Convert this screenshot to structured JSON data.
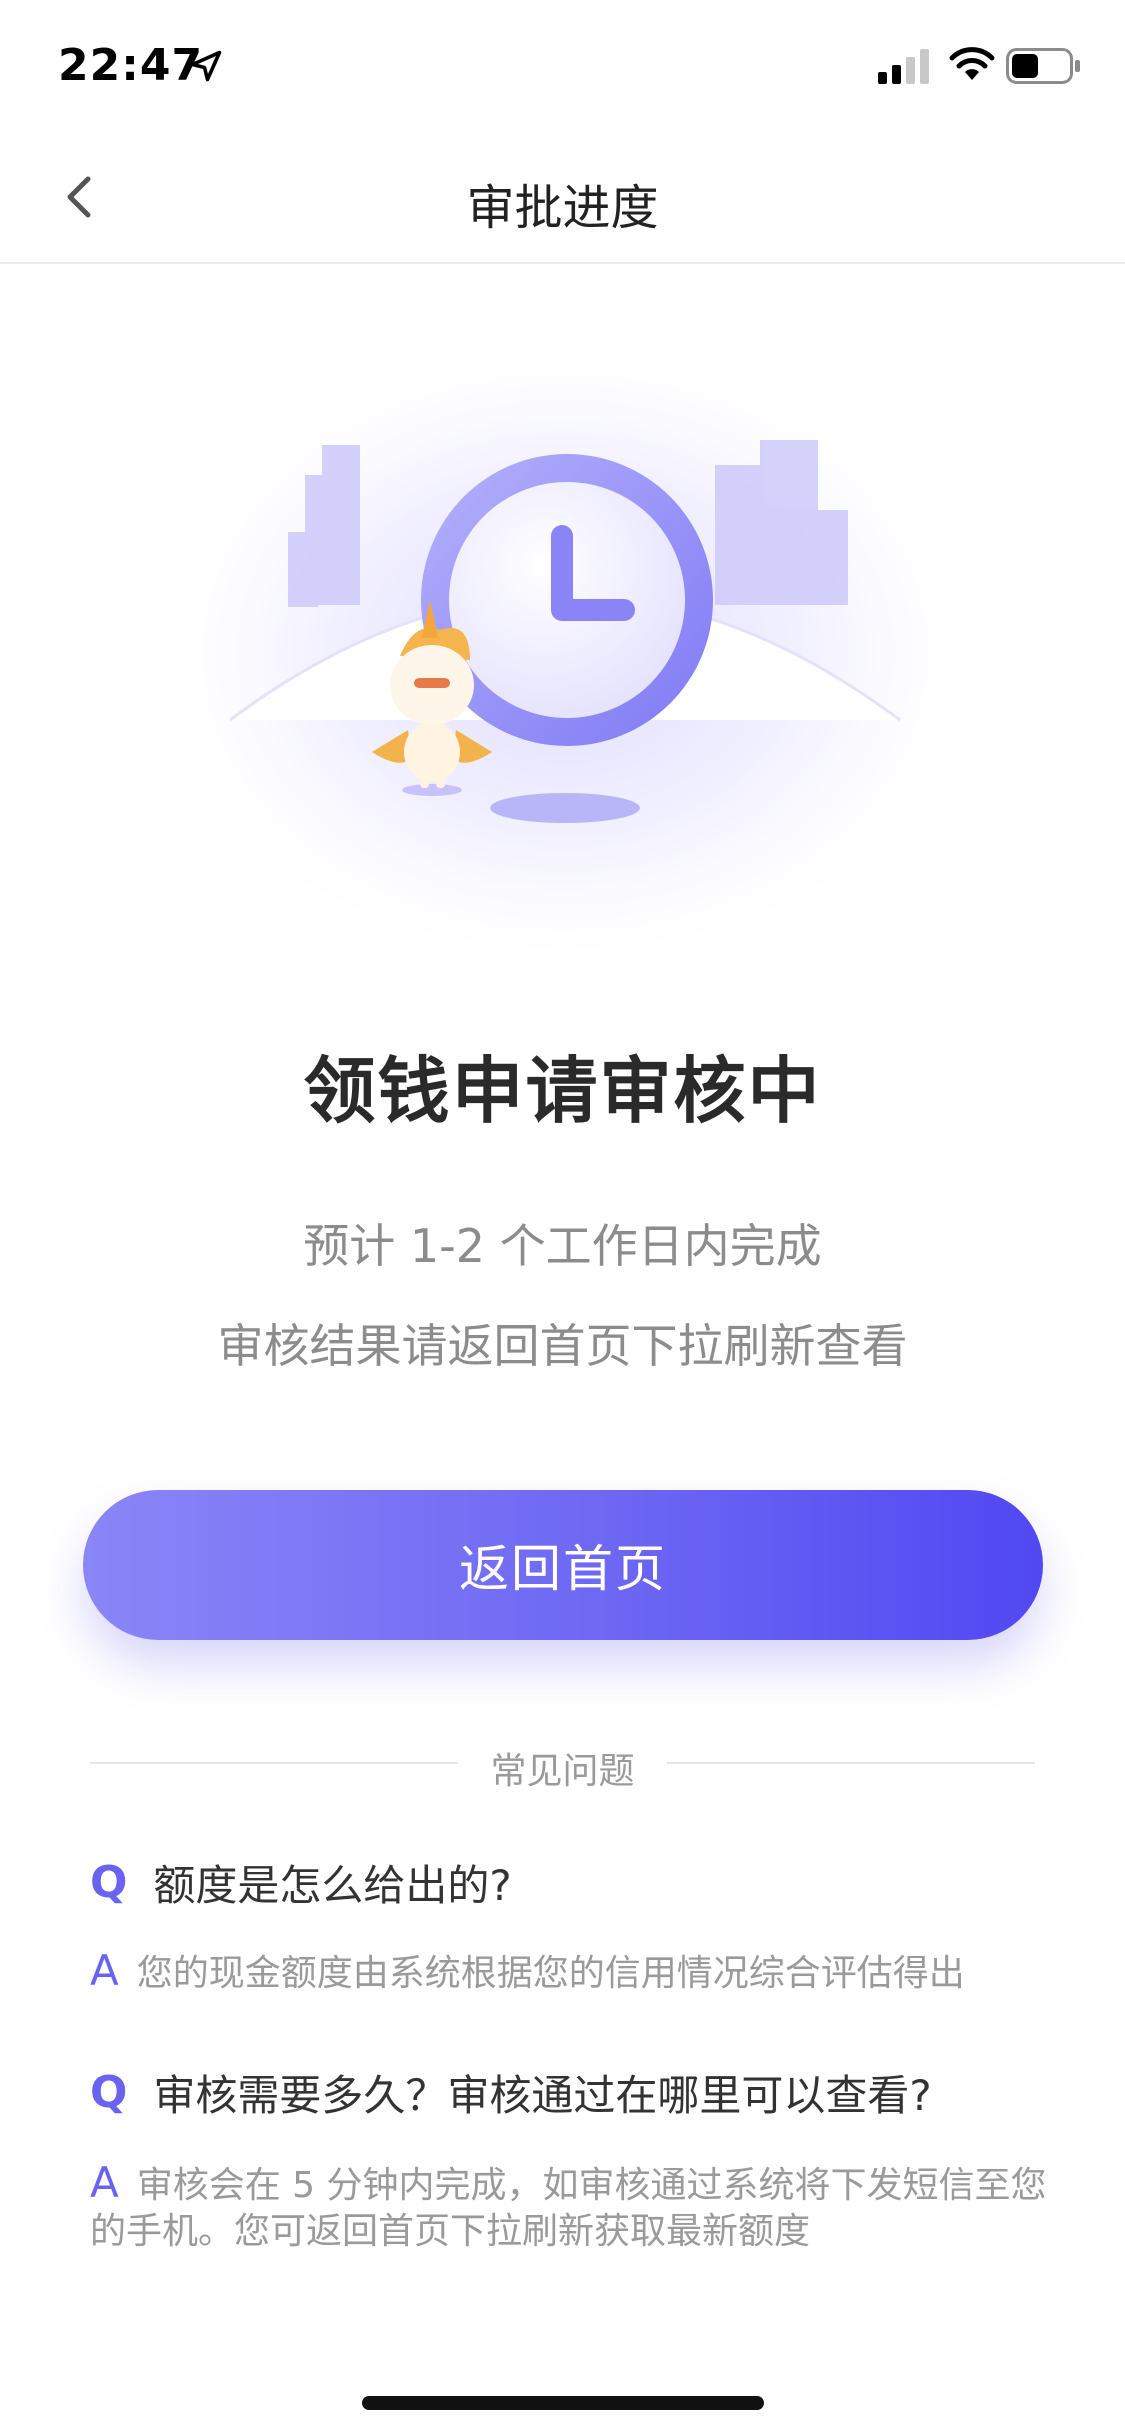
{
  "status_bar": {
    "time": "22:47"
  },
  "nav": {
    "title": "审批进度",
    "back_icon": "chevron-left-icon"
  },
  "illustration": {
    "clock_icon": "clock-icon",
    "mascot": "unicorn-mascot",
    "accent_color": "#7f79f5"
  },
  "main": {
    "title": "领钱申请审核中",
    "line1": "预计 1-2 个工作日内完成",
    "line2": "审核结果请返回首页下拉刷新查看",
    "button_label": "返回首页"
  },
  "faq": {
    "section_label": "常见问题",
    "items": [
      {
        "q_mark": "Q",
        "question": "额度是怎么给出的?",
        "a_mark": "A",
        "answer": "您的现金额度由系统根据您的信用情况综合评估得出"
      },
      {
        "q_mark": "Q",
        "question": "审核需要多久？审核通过在哪里可以查看?",
        "a_mark": "A",
        "answer": "审核会在 5 分钟内完成，如审核通过系统将下发短信至您的手机。您可返回首页下拉刷新获取最新额度"
      }
    ]
  },
  "colors": {
    "primary": "#6d67f3",
    "primary_light": "#8a86f7",
    "text_dark": "#2a2a2a",
    "text_muted": "#8c8c8c"
  }
}
